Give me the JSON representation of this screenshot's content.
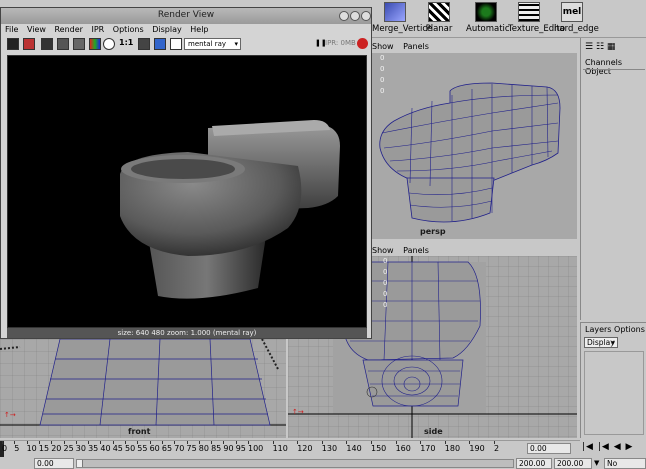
{
  "render_view": {
    "title": "Render View",
    "menu": [
      "File",
      "View",
      "Render",
      "IPR",
      "Options",
      "Display",
      "Help"
    ],
    "renderer": "mental ray",
    "ratio_label": "1:1",
    "ipr_label": "IPR: 0MB",
    "status": "size: 640  480 zoom: 1.000  (mental ray)"
  },
  "shelf": [
    {
      "label": "Merge_Vertice",
      "icon": "merge-icon"
    },
    {
      "label": "Planar",
      "icon": "planar-map-icon"
    },
    {
      "label": "Automatic",
      "icon": "automatic-map-icon"
    },
    {
      "label": "Texture_Edito",
      "icon": "texture-editor-icon"
    },
    {
      "label": "hard_edge",
      "icon": "mel-script-icon",
      "icon_text": "mel"
    }
  ],
  "persp_view": {
    "menu": [
      "Show",
      "Panels"
    ],
    "label": "persp",
    "stats": [
      "0",
      "0",
      "0",
      "0"
    ]
  },
  "side_view": {
    "menu": [
      "Show",
      "Panels"
    ],
    "label": "side",
    "stats": [
      "0",
      "0",
      "0",
      "0",
      "0"
    ]
  },
  "front_view": {
    "label": "front"
  },
  "channel_box": {
    "tabs": [
      "Channels",
      "Object"
    ]
  },
  "layer_editor": {
    "tabs": [
      "Layers",
      "Options"
    ],
    "mode": "Display"
  },
  "timeline": {
    "ticks": [
      "0",
      "5",
      "10",
      "15",
      "20",
      "25",
      "30",
      "35",
      "40",
      "45",
      "50",
      "55",
      "60",
      "65",
      "70",
      "75",
      "80",
      "85",
      "90",
      "95",
      "100",
      "110",
      "120",
      "130",
      "140",
      "150",
      "160",
      "170",
      "180",
      "190",
      "2"
    ],
    "current_frame": "0.00"
  },
  "range": {
    "start": "0.00",
    "end": "200.00",
    "end2": "200.00",
    "character_set": "No Character S"
  },
  "colors": {
    "accent": "#1a1a8c",
    "wire": "#20208a",
    "grid": "#7f7f7f"
  }
}
